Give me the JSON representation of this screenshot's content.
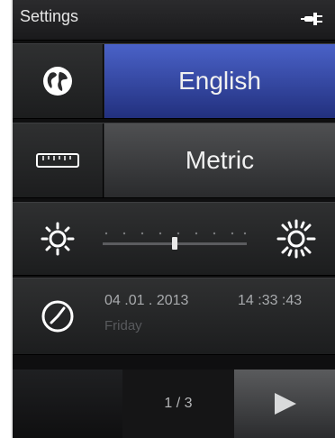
{
  "statusbar": {
    "title": "Settings",
    "icon": "plug-icon"
  },
  "rows": {
    "language": {
      "icon": "globe-icon",
      "value": "English",
      "accent": "#3a4fb0"
    },
    "units": {
      "icon": "ruler-icon",
      "value": "Metric"
    },
    "brightness": {
      "icons": [
        "sun-low-icon",
        "sun-high-icon"
      ],
      "level": 0.5
    },
    "datetime": {
      "icon": "clock-icon",
      "date": "04 .01 . 2013",
      "time": "14 :33 :43",
      "weekday": "Friday"
    }
  },
  "footer": {
    "page": "1 / 3",
    "next_icon": "play-icon"
  }
}
